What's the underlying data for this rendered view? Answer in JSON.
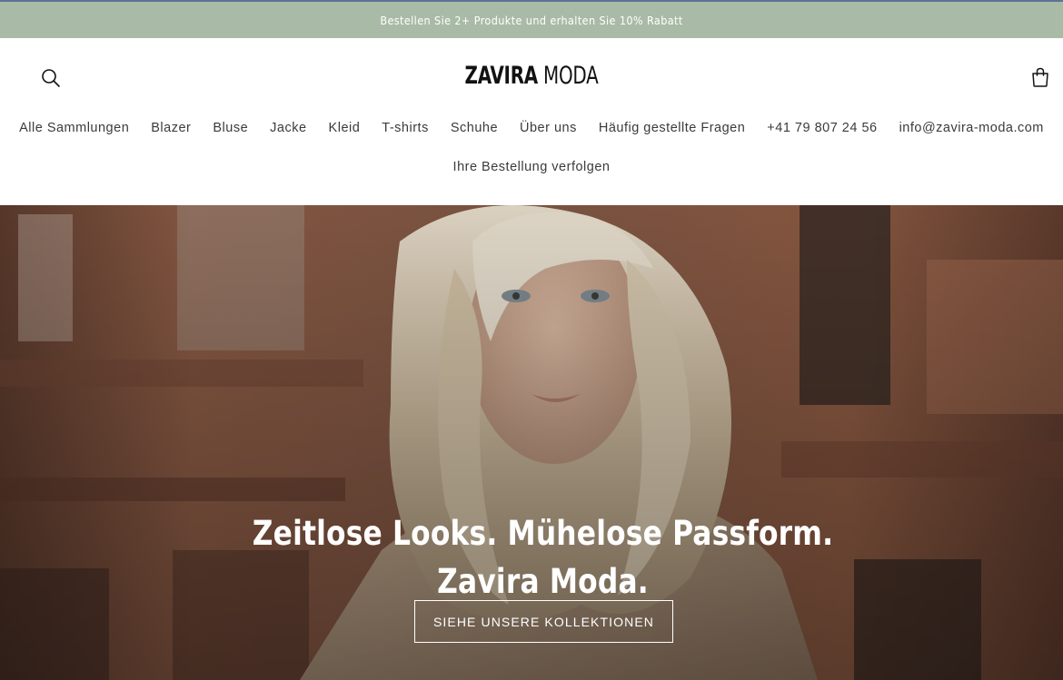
{
  "announcement": {
    "text": "Bestellen Sie 2+ Produkte und erhalten Sie 10% Rabatt"
  },
  "header": {
    "logo_bold": "ZAVIRA",
    "logo_light": "MODA",
    "search_icon": "search-icon",
    "cart_icon": "cart-icon",
    "nav_row_1": [
      "Alle Sammlungen",
      "Blazer",
      "Bluse",
      "Jacke",
      "Kleid",
      "T-shirts",
      "Schuhe",
      "Über uns",
      "Häufig gestellte Fragen",
      "+41 79 807 24 56",
      "info@zavira-moda.com"
    ],
    "nav_row_2": [
      "Ihre Bestellung verfolgen"
    ]
  },
  "hero": {
    "heading": "Zeitlose Looks. Mühelose Passform. Zavira Moda.",
    "button_label": "SIEHE UNSERE KOLLEKTIONEN"
  },
  "colors": {
    "announcement_bg": "#a9bba6",
    "announcement_border": "#5a7394",
    "text_dark": "#121212",
    "nav_text": "#3b3b3b",
    "hero_text": "#ffffff"
  }
}
